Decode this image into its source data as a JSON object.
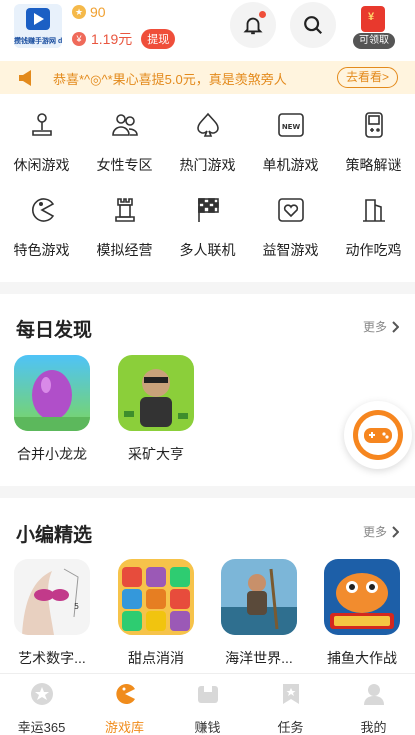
{
  "header": {
    "logo_text": "攒钱赚手游网 dzhuan.cn",
    "coins": "90",
    "cash": "1.19元",
    "withdraw_label": "提现",
    "redpack_label": "可领取"
  },
  "notice": {
    "text": "恭喜*^◎^*果心喜提5.0元，真是羡煞旁人",
    "button": "去看看>"
  },
  "categories": [
    {
      "label": "休闲游戏",
      "icon": "joystick-icon"
    },
    {
      "label": "女性专区",
      "icon": "users-icon"
    },
    {
      "label": "热门游戏",
      "icon": "spade-icon"
    },
    {
      "label": "单机游戏",
      "icon": "new-box-icon"
    },
    {
      "label": "策略解谜",
      "icon": "gameboy-icon"
    },
    {
      "label": "特色游戏",
      "icon": "pacman-icon"
    },
    {
      "label": "模拟经营",
      "icon": "rook-icon"
    },
    {
      "label": "多人联机",
      "icon": "checkered-flag-icon"
    },
    {
      "label": "益智游戏",
      "icon": "heart-box-icon"
    },
    {
      "label": "动作吃鸡",
      "icon": "building-icon"
    }
  ],
  "daily": {
    "title": "每日发现",
    "more": "更多",
    "games": [
      {
        "name": "合并小龙龙"
      },
      {
        "name": "采矿大亨"
      }
    ]
  },
  "editor": {
    "title": "小编精选",
    "more": "更多",
    "games": [
      {
        "name": "艺术数字..."
      },
      {
        "name": "甜点消消"
      },
      {
        "name": "海洋世界..."
      },
      {
        "name": "捕鱼大作战"
      }
    ]
  },
  "tabs": [
    {
      "label": "幸运365",
      "icon": "star-badge-icon"
    },
    {
      "label": "游戏库",
      "icon": "pacman-icon"
    },
    {
      "label": "赚钱",
      "icon": "wallet-icon"
    },
    {
      "label": "任务",
      "icon": "bookmark-star-icon"
    },
    {
      "label": "我的",
      "icon": "person-icon"
    }
  ],
  "colors": {
    "accent": "#f08c1c",
    "red": "#ef4e3a",
    "notice_bg": "#fff4de"
  }
}
